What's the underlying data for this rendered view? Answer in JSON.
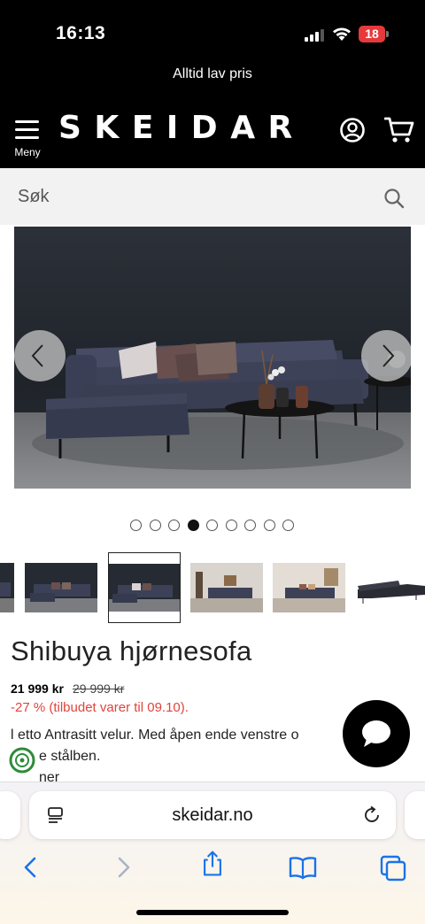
{
  "status_bar": {
    "time": "16:13",
    "battery": "18"
  },
  "promo": {
    "text": "Alltid lav pris"
  },
  "header": {
    "menu_label": "Meny",
    "logo": "SKEIDAR"
  },
  "search": {
    "placeholder": "Søk"
  },
  "carousel": {
    "total_images": 9,
    "active_index": 3
  },
  "product": {
    "title": "Shibuya hjørnesofa",
    "price": "21 999 kr",
    "old_price": "29 999 kr",
    "discount": "-27 % (tilbudet varer til 09.10).",
    "description_line1": "l etto Antrasitt velur. Med åpen ende venstre o",
    "description_line2": "e stålben.",
    "description_line3": "ner"
  },
  "browser": {
    "url": "skeidar.no"
  },
  "colors": {
    "black": "#000000",
    "discount_red": "#e0443c",
    "battery_red": "#e5393b"
  },
  "icons": [
    "hamburger-icon",
    "user-icon",
    "cart-icon",
    "search-icon",
    "chevron-left-icon",
    "chevron-right-icon",
    "chat-icon",
    "eco-badge-icon",
    "tabs-icon",
    "reload-icon",
    "share-icon",
    "bookmarks-icon",
    "tab-overview-icon"
  ]
}
